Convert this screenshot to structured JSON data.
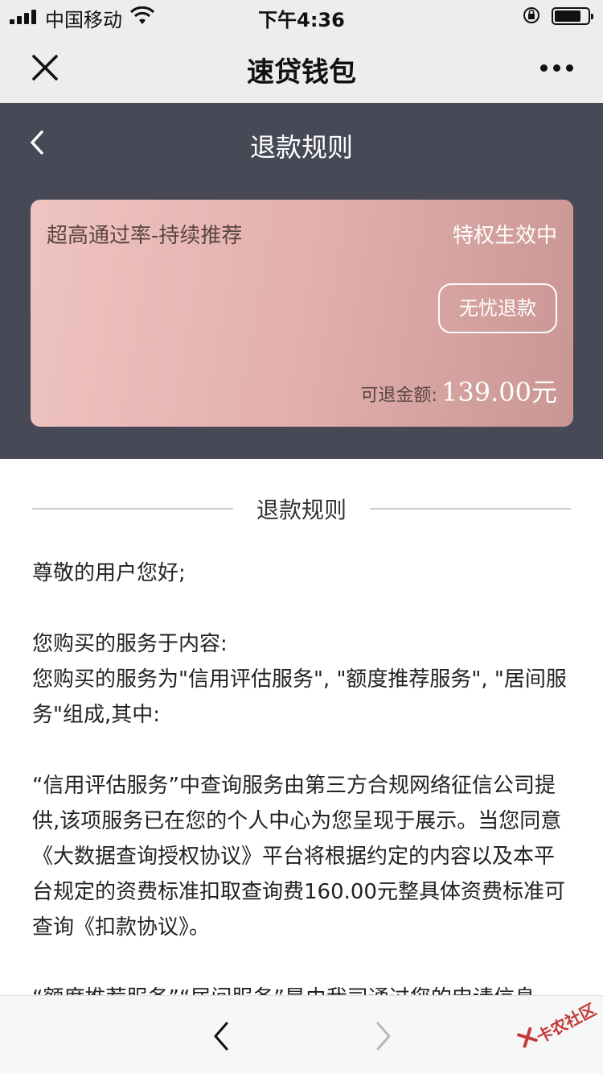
{
  "status_bar": {
    "carrier": "中国移动",
    "time": "下午4:36"
  },
  "nav": {
    "title": "速贷钱包",
    "close_icon": "close-icon",
    "more_icon": "more-icon"
  },
  "header": {
    "title": "退款规则",
    "back_icon": "chevron-left-icon"
  },
  "card": {
    "slogan": "超高通过率-持续推荐",
    "status": "特权生效中",
    "badge": "无忧退款",
    "amount_label": "可退金额:",
    "amount_value": "139.00元"
  },
  "section": {
    "title": "退款规则"
  },
  "content": {
    "greeting": "尊敬的用户您好;",
    "p1_line1": "您购买的服务于内容:",
    "p1_line2": "您购买的服务为\"信用评估服务\", \"额度推荐服务\", \"居间服务\"组成,其中:",
    "p2": "“信用评估服务”中查询服务由第三方合规网络征信公司提供,该项服务已在您的个人中心为您呈现于展示。当您同意《大数据查询授权协议》平台将根据约定的内容以及本平台规定的资费标准扣取查询费160.00元整具体资费标准可查询《扣款协议》。",
    "p3_partial": "“额度推荐服务”“居间服务”是由我司通过您的申请信息"
  },
  "bottom_bar": {
    "prev_icon": "chevron-left-icon",
    "next_icon": "chevron-right-icon"
  },
  "watermark": {
    "text": "卡农社区"
  },
  "colors": {
    "header_bg": "#474a56",
    "bar_bg": "#ededed",
    "card_gradient_start": "#efc4c1",
    "card_gradient_end": "#c99693"
  }
}
